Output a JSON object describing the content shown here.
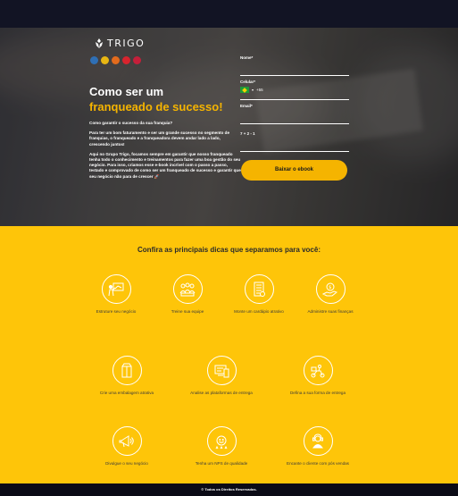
{
  "brand": {
    "name": "TRIGO"
  },
  "badges": [
    {
      "icon": "badge-blue-icon",
      "color": "#2f6fb5"
    },
    {
      "icon": "badge-gold-icon",
      "color": "#e8b613"
    },
    {
      "icon": "badge-orange-icon",
      "color": "#e36b1d"
    },
    {
      "icon": "badge-red-icon",
      "color": "#d8242e"
    },
    {
      "icon": "badge-crimson-icon",
      "color": "#c41f3a"
    }
  ],
  "hero": {
    "title_line1": "Como ser um",
    "title_line2": "franqueado de sucesso!",
    "p1": "Como garantir o sucesso da sua franquia?",
    "p2": "Para ter um bom faturamento e ser um grande sucesso no segmento de franquias, o franqueado e a franqueadora devem andar lado a lado, crescendo juntos!",
    "p3": "Aqui no Grupo Trigo, focamos sempre em garantir que nosso franqueado tenha todo o conhecimento e treinamentos para fazer uma boa gestão do seu negócio. Para isso, criamos esse e-book incrível com o passo a passo, testado e comprovado de como ser um franqueado de sucesso e garantir que seu negócio não para de crescer 🚀"
  },
  "form": {
    "name_label": "Nome*",
    "phone_label": "Celular*",
    "phone_code": "+55",
    "email_label": "Email*",
    "captcha_label": "7 + 2 - 1",
    "submit_label": "Baixar o ebook"
  },
  "tips": {
    "title": "Confira as principais dicas que separamos para você:",
    "items": [
      {
        "label": "Estruture seu negócio",
        "icon": "presenter-board-icon"
      },
      {
        "label": "Treine sua equipe",
        "icon": "team-icon"
      },
      {
        "label": "Monte um cardápio atrativo",
        "icon": "menu-card-icon"
      },
      {
        "label": "Administre suas finanças",
        "icon": "money-hand-icon"
      },
      {
        "label": "Crie uma embalagem atrativa",
        "icon": "package-icon"
      },
      {
        "label": "Analise as plataformas de entrega",
        "icon": "devices-icon"
      },
      {
        "label": "Defina a sua forma de entrega",
        "icon": "delivery-scooter-icon"
      },
      {
        "label": "Divulgue o seu negócio",
        "icon": "megaphone-icon"
      },
      {
        "label": "Tenha um NPS de qualidade",
        "icon": "rating-icon"
      },
      {
        "label": "Encante o cliente com pós vendas",
        "icon": "customer-service-icon"
      }
    ]
  },
  "footer": {
    "text": "© Todos os Direitos Reservados."
  },
  "colors": {
    "accent": "#f5b400",
    "yellow_bg": "#fec509",
    "dark": "#0b0b16"
  }
}
